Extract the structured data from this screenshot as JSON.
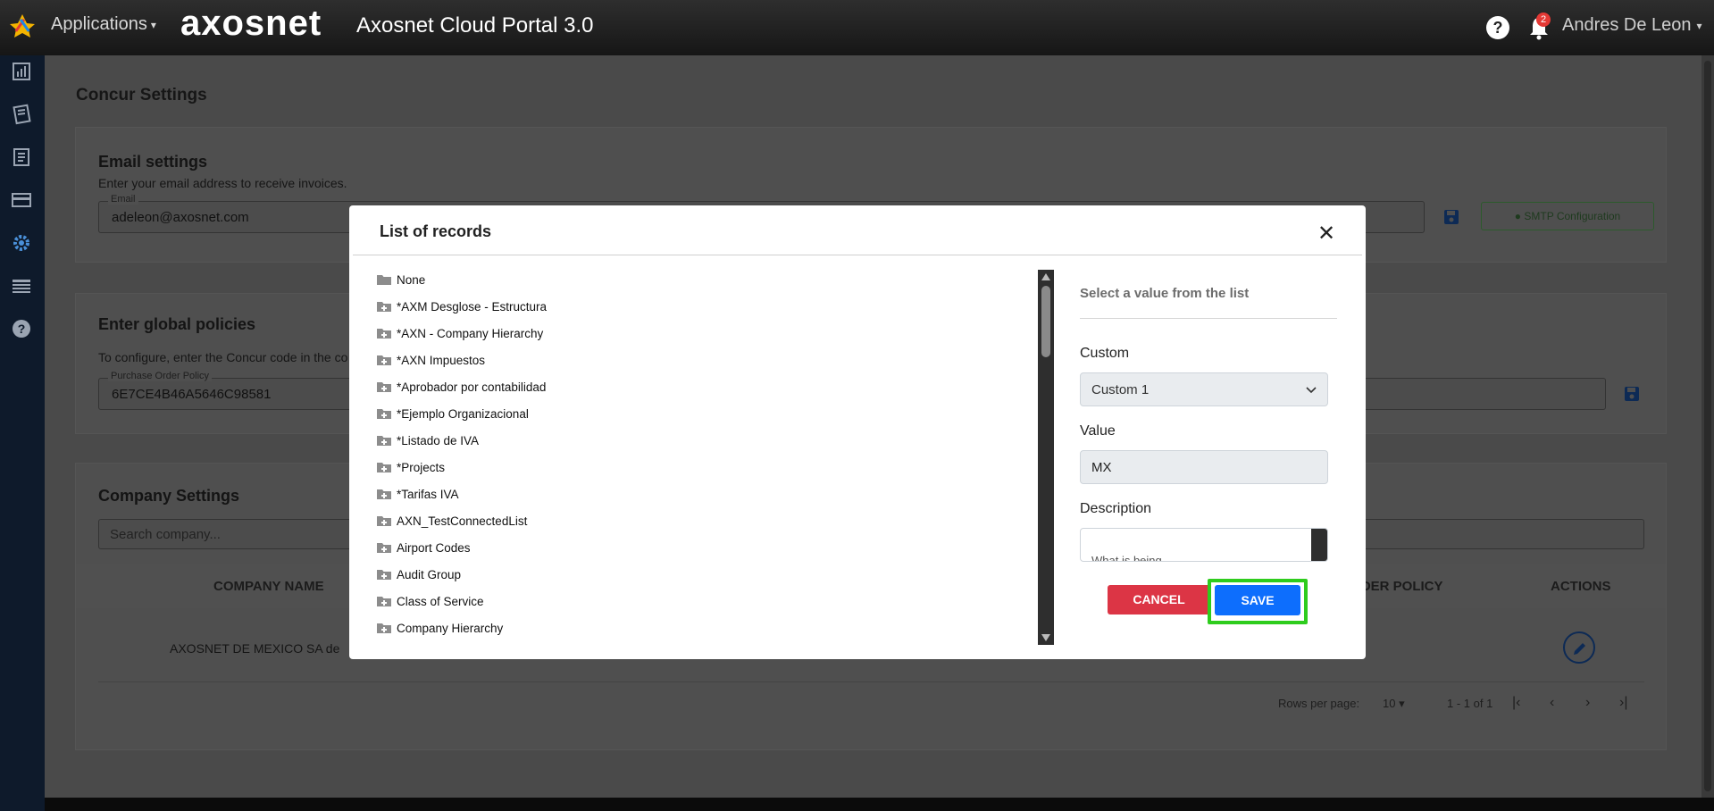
{
  "topbar": {
    "applications_label": "Applications",
    "brand": "axosnet",
    "portal_title": "Axosnet Cloud Portal 3.0",
    "help_glyph": "?",
    "notifications_count": "2",
    "user_name": "Andres De Leon"
  },
  "sidebar": {
    "icons": [
      "chart-icon",
      "notebook-icon",
      "document-icon",
      "card-icon",
      "gear-icon",
      "table-icon",
      "help-icon"
    ]
  },
  "page": {
    "title": "Concur Settings",
    "email_settings": {
      "heading": "Email settings",
      "description": "Enter your email address to receive invoices.",
      "email_label": "Email",
      "email_value": "adeleon@axosnet.com",
      "smtp_button": "SMTP Configuration"
    },
    "global_policies": {
      "heading": "Enter global policies",
      "description": "To configure, enter the Concur code in the co",
      "po_label": "Purchase Order Policy",
      "po_value": "6E7CE4B46A5646C98581"
    },
    "company_settings": {
      "heading": "Company Settings",
      "search_placeholder": "Search company...",
      "col_company_name": "COMPANY NAME",
      "col_order_policy": "RDER POLICY",
      "col_actions": "ACTIONS",
      "row_company": "AXOSNET DE MEXICO SA de",
      "rows_per_page_label": "Rows per page:",
      "rows_per_page_value": "10",
      "range": "1 - 1 of 1"
    }
  },
  "modal": {
    "title": "List of records",
    "close_glyph": "✕",
    "records": [
      {
        "label": "None",
        "icon": "folder-icon"
      },
      {
        "label": "*AXM Desglose - Estructura",
        "icon": "folder-plus-icon"
      },
      {
        "label": "*AXN - Company Hierarchy",
        "icon": "folder-plus-icon"
      },
      {
        "label": "*AXN Impuestos",
        "icon": "folder-plus-icon"
      },
      {
        "label": "*Aprobador por contabilidad",
        "icon": "folder-plus-icon"
      },
      {
        "label": "*Ejemplo Organizacional",
        "icon": "folder-plus-icon"
      },
      {
        "label": "*Listado de IVA",
        "icon": "folder-plus-icon"
      },
      {
        "label": "*Projects",
        "icon": "folder-plus-icon"
      },
      {
        "label": "*Tarifas IVA",
        "icon": "folder-plus-icon"
      },
      {
        "label": "AXN_TestConnectedList",
        "icon": "folder-plus-icon"
      },
      {
        "label": "Airport Codes",
        "icon": "folder-plus-icon"
      },
      {
        "label": "Audit Group",
        "icon": "folder-plus-icon"
      },
      {
        "label": "Class of Service",
        "icon": "folder-plus-icon"
      },
      {
        "label": "Company Hierarchy",
        "icon": "folder-plus-icon"
      }
    ],
    "pane_title": "Select a value from the list",
    "custom_label": "Custom",
    "custom_value": "Custom 1",
    "value_label": "Value",
    "value_value": "MX",
    "description_label": "Description",
    "description_partial": "What is being ...",
    "cancel_label": "CANCEL",
    "save_label": "SAVE",
    "colors": {
      "cancel": "#dc3545",
      "save": "#0d6efd",
      "highlight": "#2ecc1d"
    }
  }
}
